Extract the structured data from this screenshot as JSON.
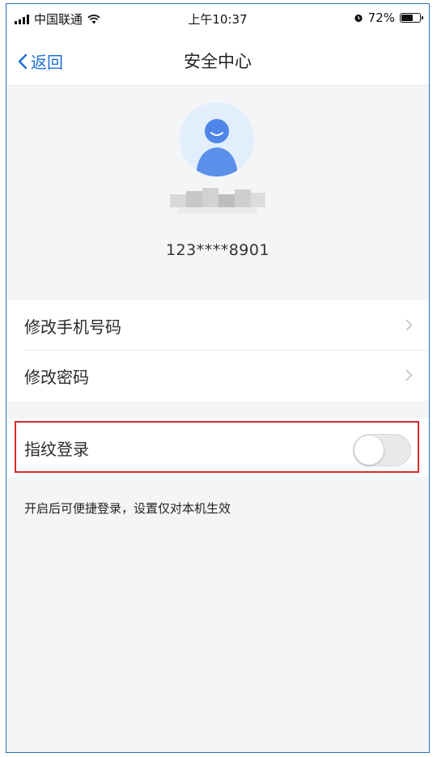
{
  "status_bar": {
    "carrier": "中国联通",
    "time": "上午10:37",
    "battery": "72%",
    "battery_level": 0.72,
    "icons": [
      "signal-icon",
      "wifi-icon",
      "alarm-icon",
      "battery-icon"
    ]
  },
  "nav": {
    "back_label": "返回",
    "title": "安全中心",
    "accent_color": "#1f6fd6"
  },
  "profile": {
    "masked_phone": "123****8901"
  },
  "settings": {
    "items": [
      {
        "label": "修改手机号码"
      },
      {
        "label": "修改密码"
      }
    ]
  },
  "fingerprint": {
    "label": "指纹登录",
    "enabled": false,
    "hint": "开启后可便捷登录，设置仅对本机生效",
    "highlight_color": "#d42a2a"
  }
}
